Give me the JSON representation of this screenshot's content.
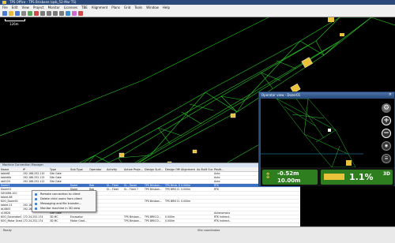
{
  "window": {
    "title": "TPS Office - TPS Brisbane (qsb_52-Mar TS)"
  },
  "menu": [
    "File",
    "Edit",
    "View",
    "Project",
    "Monitor",
    "Licenses",
    "TBE",
    "Alignment",
    "Plans",
    "Grid",
    "Tools",
    "Window",
    "Help"
  ],
  "map": {
    "scale_label": "126m"
  },
  "grid": {
    "title": "Machine Connection Manager",
    "columns": [
      "Name",
      "IP",
      "Type",
      "Sub Type",
      "Operator",
      "Activity",
      "Active Proje...",
      "Design Surf...",
      "Design Offs...",
      "Alignment",
      "As Built Sur...",
      "Positi..."
    ],
    "rows": [
      [
        "tablet8",
        "192.168.252.110",
        "Site Gate",
        "",
        "",
        "",
        "",
        "",
        "",
        "",
        "",
        "Auto"
      ],
      [
        "tablet6x",
        "192.168.252.115",
        "Site Gate",
        "",
        "",
        "",
        "",
        "",
        "",
        "",
        "",
        "Auto"
      ],
      [
        "ab0125",
        "192.168.252.112",
        "Site Gate",
        "",
        "",
        "",
        "",
        "",
        "",
        "",
        "",
        "Auto"
      ],
      [
        "Dozer2",
        "",
        "",
        "Dozer",
        "Rob",
        "Sl... Fleet",
        "Sl... Dozer",
        "TPS Brisban...",
        "TPS Brisb. D...",
        "0.000m",
        "",
        "RTK"
      ],
      [
        "Dozer01",
        "",
        "",
        "Dozer",
        "Rob",
        "Sl... Fleet",
        "Sl... Fleet 7",
        "TPS Brisban...",
        "TPS BRIS D...",
        "0.000m",
        "",
        "RTK"
      ],
      [
        "GEOSR6-10C",
        "",
        "",
        "",
        "",
        "",
        "",
        "",
        "",
        "",
        "",
        ""
      ],
      [
        "tablet-66",
        "",
        "",
        "",
        "",
        "",
        "",
        "",
        "",
        "",
        "",
        ""
      ],
      [
        "KOO_Dozer01",
        "",
        "",
        "Dozer",
        "",
        "",
        "",
        "TPS Brisban...",
        "TPS BRIS D...",
        "0.000m",
        "",
        ""
      ],
      [
        "tablet-11",
        "192.168.252.118",
        "Site Gate",
        "",
        "",
        "",
        "",
        "",
        "",
        "",
        "",
        ""
      ],
      [
        "bf-0805",
        "192.168.252.116",
        "Site Gate",
        "",
        "",
        "",
        "",
        "",
        "",
        "",
        "",
        ""
      ],
      [
        "sf-0826",
        "",
        "Site Gate",
        "",
        "",
        "",
        "",
        "",
        "",
        "",
        "",
        "Autonomous"
      ],
      [
        "KOO_Excavator01",
        "172.24.252.174",
        "3D MC",
        "Excavator",
        "",
        "",
        "TPS Brisban...",
        "TPS BRIS D...",
        "0.000m",
        "",
        "",
        "RTK Indirect..."
      ],
      [
        "KOO_Motor Grader...",
        "172.24.252.174",
        "3D MC",
        "Motor Grad...",
        "",
        "",
        "TPS Brisban...",
        "TPS BRIS D...",
        "0.000m",
        "",
        "",
        "RTK Indirect..."
      ]
    ],
    "selected_row": 3
  },
  "context_menu": {
    "items": [
      "Remote connection to client",
      "Delete child users from client",
      "Messaging and file transfer...",
      "Monitor machine in 3D view"
    ]
  },
  "operator_view": {
    "title": "Operator view - Dozer01",
    "vertical_cut": "-0.52m",
    "horizontal": "10.00m",
    "slope_pct": "1.1%",
    "mode_badge": "3D",
    "colors": {
      "panel_green": "#2e7d1f",
      "blade_yellow": "#e8c23a"
    }
  },
  "status": {
    "left": "Ready",
    "center": "Site coordinates"
  }
}
